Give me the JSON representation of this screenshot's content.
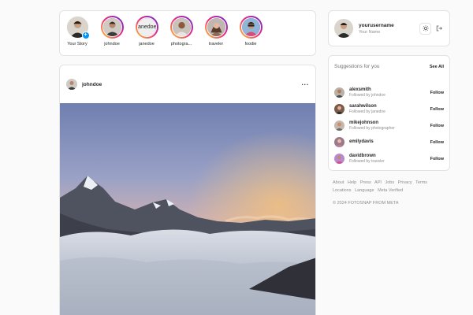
{
  "stories": [
    {
      "label": "Your Story",
      "own": true
    },
    {
      "label": "johndoe"
    },
    {
      "label": "janedoe",
      "placeholder_text": "janedoe"
    },
    {
      "label": "photogra..."
    },
    {
      "label": "traveler"
    },
    {
      "label": "foodie"
    }
  ],
  "post": {
    "username": "johndoe",
    "more_label": "···"
  },
  "profile": {
    "username": "yourusername",
    "name": "Your Name",
    "theme_icon": "sun-icon",
    "logout_icon": "logout-icon"
  },
  "suggestions": {
    "title": "Suggestions for you",
    "see_all": "See All",
    "items": [
      {
        "username": "alexsmith",
        "sub": "Followed by johndoe",
        "action": "Follow"
      },
      {
        "username": "sarahwilson",
        "sub": "Followed by janedoe",
        "action": "Follow"
      },
      {
        "username": "mikejohnson",
        "sub": "Followed by photographer",
        "action": "Follow"
      },
      {
        "username": "emilydavis",
        "sub": "",
        "action": "Follow"
      },
      {
        "username": "davidbrown",
        "sub": "Followed by traveler",
        "action": "Follow"
      }
    ]
  },
  "footer": {
    "links": [
      "About",
      "Help",
      "Press",
      "API",
      "Jobs",
      "Privacy",
      "Terms",
      "Locations",
      "Language",
      "Meta Verified"
    ],
    "copyright": "© 2024 FOTOSNAP FROM META"
  }
}
